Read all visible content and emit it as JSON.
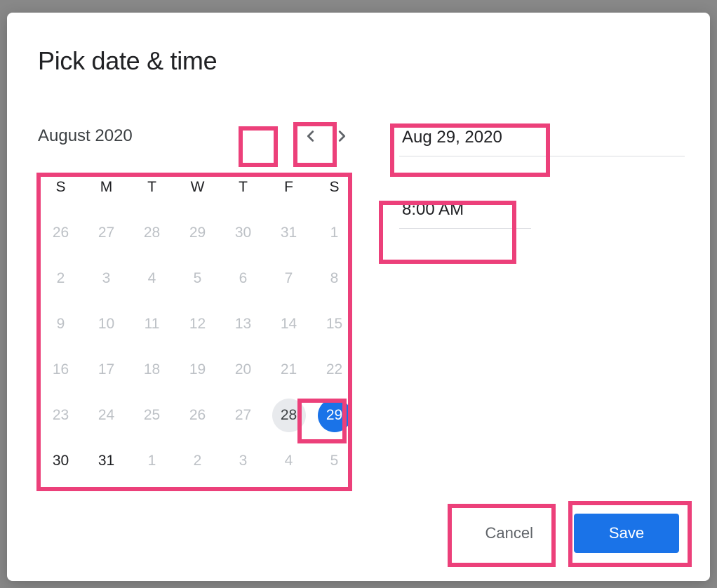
{
  "title": "Pick date & time",
  "calendar": {
    "month_label": "August 2020",
    "weekdays": [
      "S",
      "M",
      "T",
      "W",
      "T",
      "F",
      "S"
    ],
    "rows": [
      [
        {
          "n": "26",
          "state": "other"
        },
        {
          "n": "27",
          "state": "other"
        },
        {
          "n": "28",
          "state": "other"
        },
        {
          "n": "29",
          "state": "other"
        },
        {
          "n": "30",
          "state": "other"
        },
        {
          "n": "31",
          "state": "other"
        },
        {
          "n": "1",
          "state": "dim"
        }
      ],
      [
        {
          "n": "2",
          "state": "dim"
        },
        {
          "n": "3",
          "state": "dim"
        },
        {
          "n": "4",
          "state": "dim"
        },
        {
          "n": "5",
          "state": "dim"
        },
        {
          "n": "6",
          "state": "dim"
        },
        {
          "n": "7",
          "state": "dim"
        },
        {
          "n": "8",
          "state": "dim"
        }
      ],
      [
        {
          "n": "9",
          "state": "dim"
        },
        {
          "n": "10",
          "state": "dim"
        },
        {
          "n": "11",
          "state": "dim"
        },
        {
          "n": "12",
          "state": "dim"
        },
        {
          "n": "13",
          "state": "dim"
        },
        {
          "n": "14",
          "state": "dim"
        },
        {
          "n": "15",
          "state": "dim"
        }
      ],
      [
        {
          "n": "16",
          "state": "dim"
        },
        {
          "n": "17",
          "state": "dim"
        },
        {
          "n": "18",
          "state": "dim"
        },
        {
          "n": "19",
          "state": "dim"
        },
        {
          "n": "20",
          "state": "dim"
        },
        {
          "n": "21",
          "state": "dim"
        },
        {
          "n": "22",
          "state": "dim"
        }
      ],
      [
        {
          "n": "23",
          "state": "dim"
        },
        {
          "n": "24",
          "state": "dim"
        },
        {
          "n": "25",
          "state": "dim"
        },
        {
          "n": "26",
          "state": "dim"
        },
        {
          "n": "27",
          "state": "dim"
        },
        {
          "n": "28",
          "state": "today"
        },
        {
          "n": "29",
          "state": "selected"
        }
      ],
      [
        {
          "n": "30",
          "state": "in"
        },
        {
          "n": "31",
          "state": "in"
        },
        {
          "n": "1",
          "state": "other"
        },
        {
          "n": "2",
          "state": "other"
        },
        {
          "n": "3",
          "state": "other"
        },
        {
          "n": "4",
          "state": "other"
        },
        {
          "n": "5",
          "state": "other"
        }
      ]
    ]
  },
  "fields": {
    "date_value": "Aug 29, 2020",
    "time_value": "8:00 AM"
  },
  "buttons": {
    "cancel": "Cancel",
    "save": "Save"
  },
  "colors": {
    "accent": "#1a73e8",
    "highlight": "#ec407a"
  }
}
